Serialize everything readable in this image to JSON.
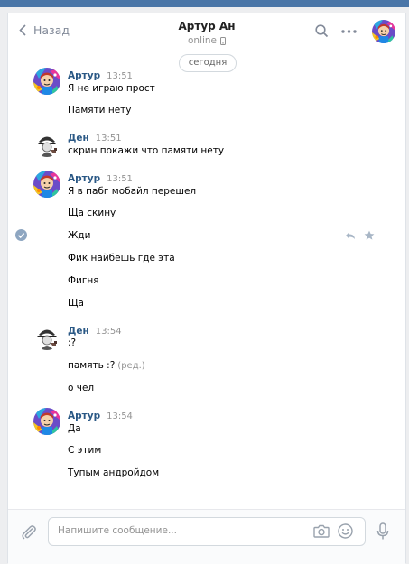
{
  "header": {
    "back_label": "Назад",
    "title": "Артур Ан",
    "status": "online"
  },
  "date_divider": "сегодня",
  "groups": [
    {
      "author": "Артур",
      "time": "13:51",
      "messages": [
        "Я не играю прост",
        "Памяти нету"
      ]
    },
    {
      "author": "Ден",
      "time": "13:51",
      "messages": [
        "скрин покажи что памяти нету"
      ]
    },
    {
      "author": "Артур",
      "time": "13:51",
      "messages": [
        "Я в пабг мобайл перешел",
        "Ща скину",
        "Жди",
        "Фик найбешь где эта",
        "Фигня",
        "Ща"
      ]
    },
    {
      "author": "Ден",
      "time": "13:54",
      "messages": [
        ":?",
        "память :?",
        "о чел"
      ],
      "edited_label": "(ред.)"
    },
    {
      "author": "Артур",
      "time": "13:54",
      "messages": [
        "Да",
        "С этим",
        "Тупым андройдом"
      ]
    }
  ],
  "composer": {
    "placeholder": "Напишите сообщение..."
  },
  "colors": {
    "accent": "#4a76a8",
    "author": "#2a5885",
    "muted": "#939393"
  },
  "icons": [
    "back-chevron-icon",
    "mobile-icon",
    "search-icon",
    "more-icon",
    "checkmark-icon",
    "reply-icon",
    "star-icon",
    "paperclip-icon",
    "camera-icon",
    "smile-icon",
    "microphone-icon"
  ]
}
